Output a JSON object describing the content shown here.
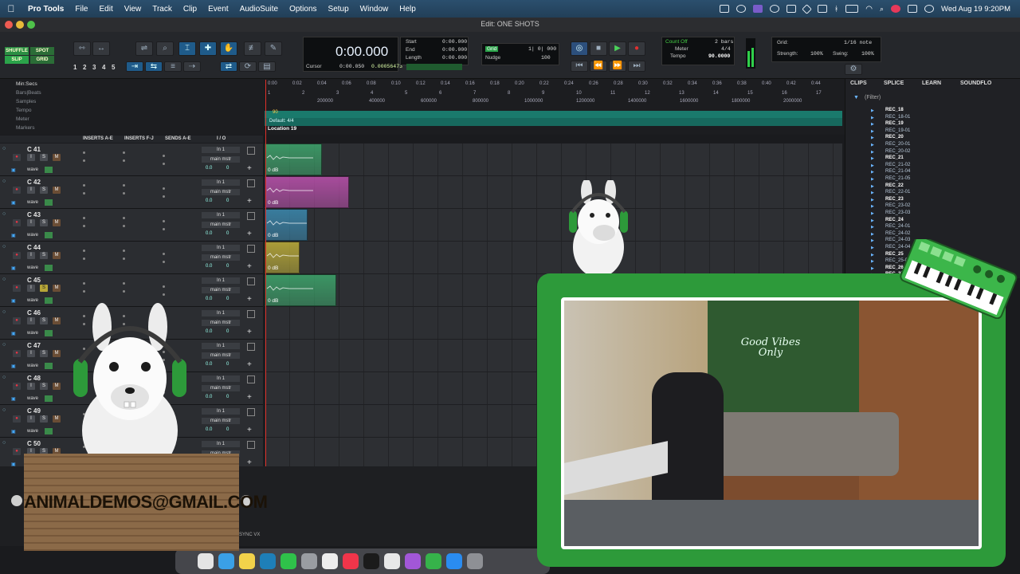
{
  "menubar": {
    "app": "Pro Tools",
    "items": [
      "File",
      "Edit",
      "View",
      "Track",
      "Clip",
      "Event",
      "AudioSuite",
      "Options",
      "Setup",
      "Window",
      "Help"
    ],
    "datetime": "Wed Aug 19  9:20PM"
  },
  "window": {
    "title": "Edit: ONE SHOTS"
  },
  "toolbar": {
    "modes": [
      "SHUFFLE",
      "SPOT",
      "SLIP",
      "GRID"
    ],
    "zoom_presets": [
      "1",
      "2",
      "3",
      "4",
      "5"
    ],
    "main_counter": "0:00.000",
    "cursor_label": "Cursor",
    "cursor_value": "0:00.050",
    "cursor_samples": "0.00056473",
    "start_label": "Start",
    "start_value": "0:00.000",
    "end_label": "End",
    "end_value": "0:00.000",
    "length_label": "Length",
    "length_value": "0:00.000",
    "grid_label": "Grid",
    "grid_value": "1| 0| 000",
    "nudge_label": "Nudge",
    "nudge_value": "100",
    "count_off": "Count Off",
    "meter_label": "Meter",
    "meter_value": "4/4",
    "tempo_label": "Tempo",
    "tempo_value": "90.0000",
    "bars_value": "2 bars",
    "grid2_label": "Grid:",
    "grid2_value": "1/16 note",
    "strength_label": "Strength:",
    "strength_value": "100%",
    "swing_label": "Swing:",
    "swing_value": "100%"
  },
  "rulers": {
    "labels": [
      "Min:Secs",
      "Bars|Beats",
      "Samples",
      "Tempo",
      "Meter",
      "Markers"
    ],
    "minsecs": [
      "0:00",
      "0:02",
      "0:04",
      "0:06",
      "0:08",
      "0:10",
      "0:12",
      "0:14",
      "0:16",
      "0:18",
      "0:20",
      "0:22",
      "0:24",
      "0:26",
      "0:28",
      "0:30",
      "0:32",
      "0:34",
      "0:36",
      "0:38",
      "0:40",
      "0:42",
      "0:44"
    ],
    "bars": [
      "1",
      "2",
      "3",
      "4",
      "5",
      "6",
      "7",
      "8",
      "9",
      "10",
      "11",
      "12",
      "13",
      "14",
      "15",
      "16",
      "17"
    ],
    "samples": [
      "200000",
      "400000",
      "600000",
      "800000",
      "1000000",
      "1200000",
      "1400000",
      "1600000",
      "1800000",
      "2000000"
    ],
    "tempo_marker": "90",
    "meter_marker": "Default: 4/4",
    "marker": "Location 19"
  },
  "columns": {
    "inserts_ae": "INSERTS A-E",
    "inserts_fj": "INSERTS F-J",
    "sends_ae": "SENDS A-E",
    "io": "I / O"
  },
  "tracks": [
    {
      "name": "C 41",
      "input": "In 1",
      "output": "main mstr",
      "vol": "0.0",
      "pan": "0",
      "mode": "wave"
    },
    {
      "name": "C 42",
      "input": "In 1",
      "output": "main mstr",
      "vol": "0.0",
      "pan": "0",
      "mode": "wave"
    },
    {
      "name": "C 43",
      "input": "In 1",
      "output": "main mstr",
      "vol": "0.0",
      "pan": "0",
      "mode": "wave"
    },
    {
      "name": "C 44",
      "input": "In 1",
      "output": "main mstr",
      "vol": "0.0",
      "pan": "0",
      "mode": "wave"
    },
    {
      "name": "C 45",
      "input": "In 1",
      "output": "main mstr",
      "vol": "0.0",
      "pan": "0",
      "mode": "wave"
    },
    {
      "name": "C 46",
      "input": "In 1",
      "output": "main mstr",
      "vol": "0.0",
      "pan": "0",
      "mode": "wave"
    },
    {
      "name": "C 47",
      "input": "In 1",
      "output": "main mstr",
      "vol": "0.0",
      "pan": "0",
      "mode": "wave"
    },
    {
      "name": "C 48",
      "input": "In 1",
      "output": "main mstr",
      "vol": "0.0",
      "pan": "0",
      "mode": "wave"
    },
    {
      "name": "C 49",
      "input": "In 1",
      "output": "main mstr",
      "vol": "0.0",
      "pan": "0",
      "mode": "wave"
    },
    {
      "name": "C 50",
      "input": "In 1",
      "output": "main mstr",
      "vol": "0.0",
      "pan": "0",
      "mode": "wave"
    }
  ],
  "clip_gain": "0 dB",
  "clip_colors": [
    "#3fae70",
    "#c653b6",
    "#3c8fb8",
    "#c9b83a",
    "#3fae70"
  ],
  "clips_panel": {
    "tabs": [
      "CLIPS",
      "SPLICE",
      "LEARN",
      "SOUNDFLO"
    ],
    "filter": "(Filter)",
    "items": [
      "REC_18",
      "REC_18-01",
      "REC_19",
      "REC_19-01",
      "REC_20",
      "REC_20-01",
      "REC_20-02",
      "REC_21",
      "REC_21-02",
      "REC_21-04",
      "REC_21-05",
      "REC_22",
      "REC_22-01",
      "REC_23",
      "REC_23-02",
      "REC_23-03",
      "REC_24",
      "REC_24-01",
      "REC_24-02",
      "REC_24-03",
      "REC_24-04",
      "REC_25",
      "REC_25-01",
      "REC_26",
      "REC_27"
    ]
  },
  "bottom": {
    "sync": "SYNC VX"
  },
  "overlay": {
    "email": "ANIMALDEMOS@GMAIL.COM",
    "neon_sign": "Good Vibes Only"
  },
  "colors": {
    "accent_green": "#2d9a3a",
    "tempo_teal": "#1a7a6c",
    "playhead": "#e0302a"
  }
}
